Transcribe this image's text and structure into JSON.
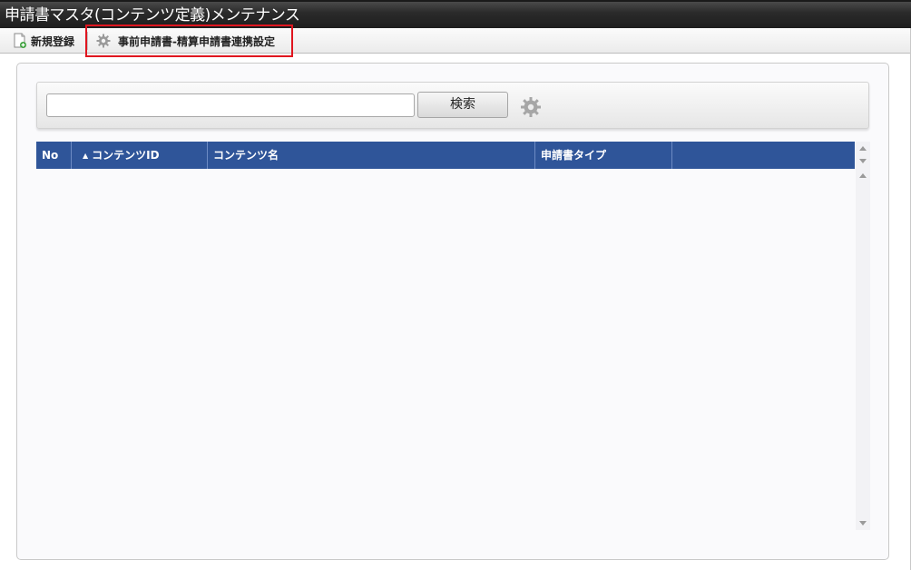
{
  "window": {
    "title": "申請書マスタ(コンテンツ定義)メンテナンス"
  },
  "toolbar": {
    "new_label": "新規登録",
    "link_label": "事前申請書-精算申請書連携設定"
  },
  "search": {
    "value": "",
    "button_label": "検索"
  },
  "grid": {
    "columns": {
      "no": "No",
      "content_id": "コンテンツID",
      "content_name": "コンテンツ名",
      "form_type": "申請書タイプ",
      "extra": ""
    },
    "sort_indicator": "▲",
    "rows": []
  },
  "colors": {
    "title_bar": "#1e1e1e",
    "grid_header": "#2f5599",
    "highlight_box": "#e0151f"
  },
  "icons": {
    "new": "new-document-icon",
    "link": "gear-icon",
    "settings": "gear-icon"
  }
}
